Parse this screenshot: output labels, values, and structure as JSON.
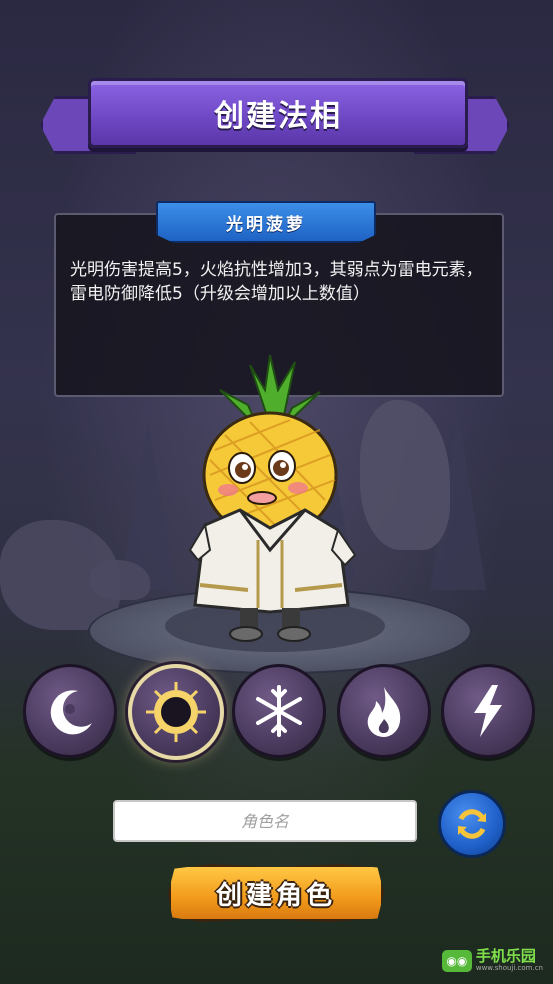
{
  "header": {
    "title": "创建法相"
  },
  "info": {
    "name": "光明菠萝",
    "description": "光明伤害提高5，火焰抗性增加3，其弱点为雷电元素，雷电防御降低5（升级会增加以上数值）"
  },
  "elements": [
    {
      "name": "moon-icon",
      "selected": false
    },
    {
      "name": "sun-icon",
      "selected": true
    },
    {
      "name": "snowflake-icon",
      "selected": false
    },
    {
      "name": "flame-icon",
      "selected": false
    },
    {
      "name": "lightning-icon",
      "selected": false
    }
  ],
  "name_input": {
    "placeholder": "角色名",
    "value": ""
  },
  "refresh": {
    "icon": "refresh-icon"
  },
  "create_button": {
    "label": "创建角色"
  },
  "watermark": {
    "brand": "手机乐园",
    "url": "www.shouji.com.cn"
  },
  "colors": {
    "banner": "#6f49c6",
    "panel_header": "#1e63c4",
    "create_button": "#f29a1b",
    "refresh": "#1e5fc8"
  }
}
